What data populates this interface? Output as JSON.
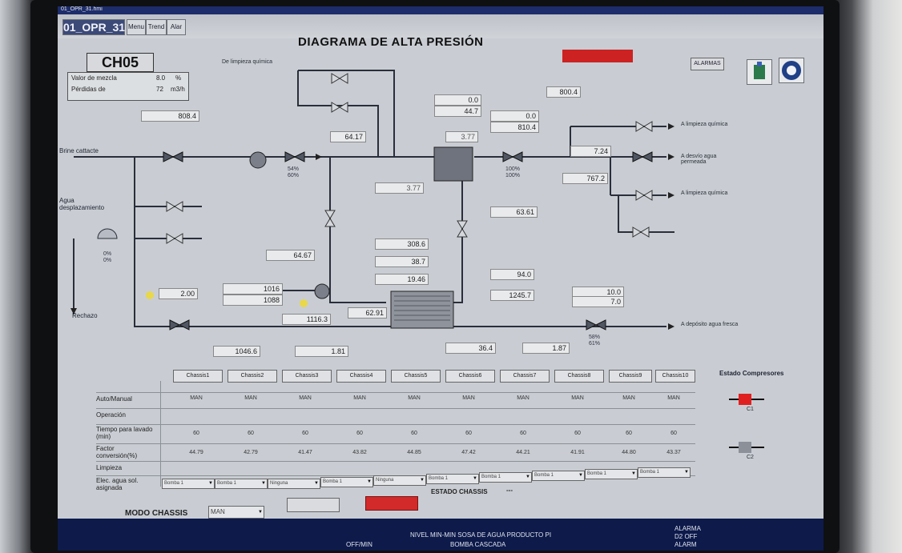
{
  "window": {
    "sys_title": "01_OPR_31.hmi",
    "tab_main": "01_OPR_31",
    "tab_btns": [
      "Menu",
      "Trend",
      "Alar"
    ],
    "title": "DIAGRAMA DE ALTA PRESIÓN",
    "top_right_btn": "ALARMAS"
  },
  "chassis": {
    "name": "CH05",
    "info": [
      {
        "label": "Valor de mezcla",
        "value": "8.0",
        "unit": "%"
      },
      {
        "label": "Pérdidas de",
        "value": "72",
        "unit": "m3/h"
      }
    ]
  },
  "labels": {
    "de_limpieza": "De limpieza química",
    "brine": "Brine cattacte",
    "agua": "Agua desplazamiento",
    "rechazo": "Rechazo",
    "a_limpieza_1": "A limpieza química",
    "a_desvio": "A desvío agua permeada",
    "a_limpieza_2": "A limpieza química",
    "a_deposito": "A depósito agua fresca"
  },
  "values": {
    "v1": "808.4",
    "v2": "64.17",
    "v3": "3.77",
    "v4": "800.4",
    "v5": "0.0",
    "v6": "44.7",
    "v7": "0.0",
    "v8": "810.4",
    "v9": "7.24",
    "v10": "767.2",
    "v11": "3.77",
    "v12": "63.61",
    "v13": "308.6",
    "v14": "38.7",
    "v15": "19.46",
    "v16": "64.67",
    "v17": "2.00",
    "v18": "1016",
    "v19": "1088",
    "v20": "1116.3",
    "v21": "62.91",
    "v22": "94.0",
    "v23": "1245.7",
    "v24": "10.0",
    "v25": "7.0",
    "v26": "1046.6",
    "v27": "1.81",
    "v28": "36.4",
    "v29": "1.87"
  },
  "pcts": {
    "p1": "54%",
    "p2": "60%",
    "p3": "100%",
    "p4": "100%",
    "p5": "0%",
    "p6": "0%",
    "p7": "58%",
    "p8": "61%"
  },
  "table": {
    "headers": [
      "Chassis1",
      "Chassis2",
      "Chassis3",
      "Chassis4",
      "Chassis5",
      "Chassis6",
      "Chassis7",
      "Chassis8",
      "Chassis9",
      "Chassis10"
    ],
    "row_labels": [
      "Auto/Manual",
      "Operación",
      "Tiempo para lavado (min)",
      "Factor conversión(%)",
      "Limpieza",
      "Elec. agua sol. asignada"
    ],
    "auto": [
      "MAN",
      "MAN",
      "MAN",
      "MAN",
      "MAN",
      "MAN",
      "MAN",
      "MAN",
      "MAN",
      "MAN"
    ],
    "tiempo": [
      "60",
      "60",
      "60",
      "60",
      "60",
      "60",
      "60",
      "60",
      "60",
      "60"
    ],
    "factor": [
      "44.79",
      "42.79",
      "41.47",
      "43.82",
      "44.85",
      "47.42",
      "44.21",
      "41.91",
      "44.80",
      "43.37"
    ],
    "dropdowns": [
      "Bomba 1",
      "Bomba 1",
      "Ninguna",
      "Bomba 1",
      "Ninguna",
      "Bomba 1",
      "Bomba 1",
      "Bomba 1",
      "Bomba 1",
      "Bomba 1"
    ]
  },
  "bottom": {
    "modo_label": "MODO CHASSIS",
    "modo_value": "MAN",
    "estado_label": "ESTADO CHASSIS",
    "estado_value": "---",
    "estado_comp": "Estado Compresores"
  },
  "compressors": [
    "C1",
    "C2"
  ],
  "status_bar": {
    "left": "OFF/MIN",
    "msg1": "NIVEL MIN-MIN SOSA DE AGUA PRODUCTO PI",
    "msg2": "BOMBA CASCADA",
    "alarm": "ALARMA",
    "alarm2": "D2 OFF",
    "alarm3": "ALARM"
  },
  "colors": {
    "red_alarm": "#cc2222",
    "screen": "#c9cdd3",
    "compressor_active": "#e02020"
  }
}
